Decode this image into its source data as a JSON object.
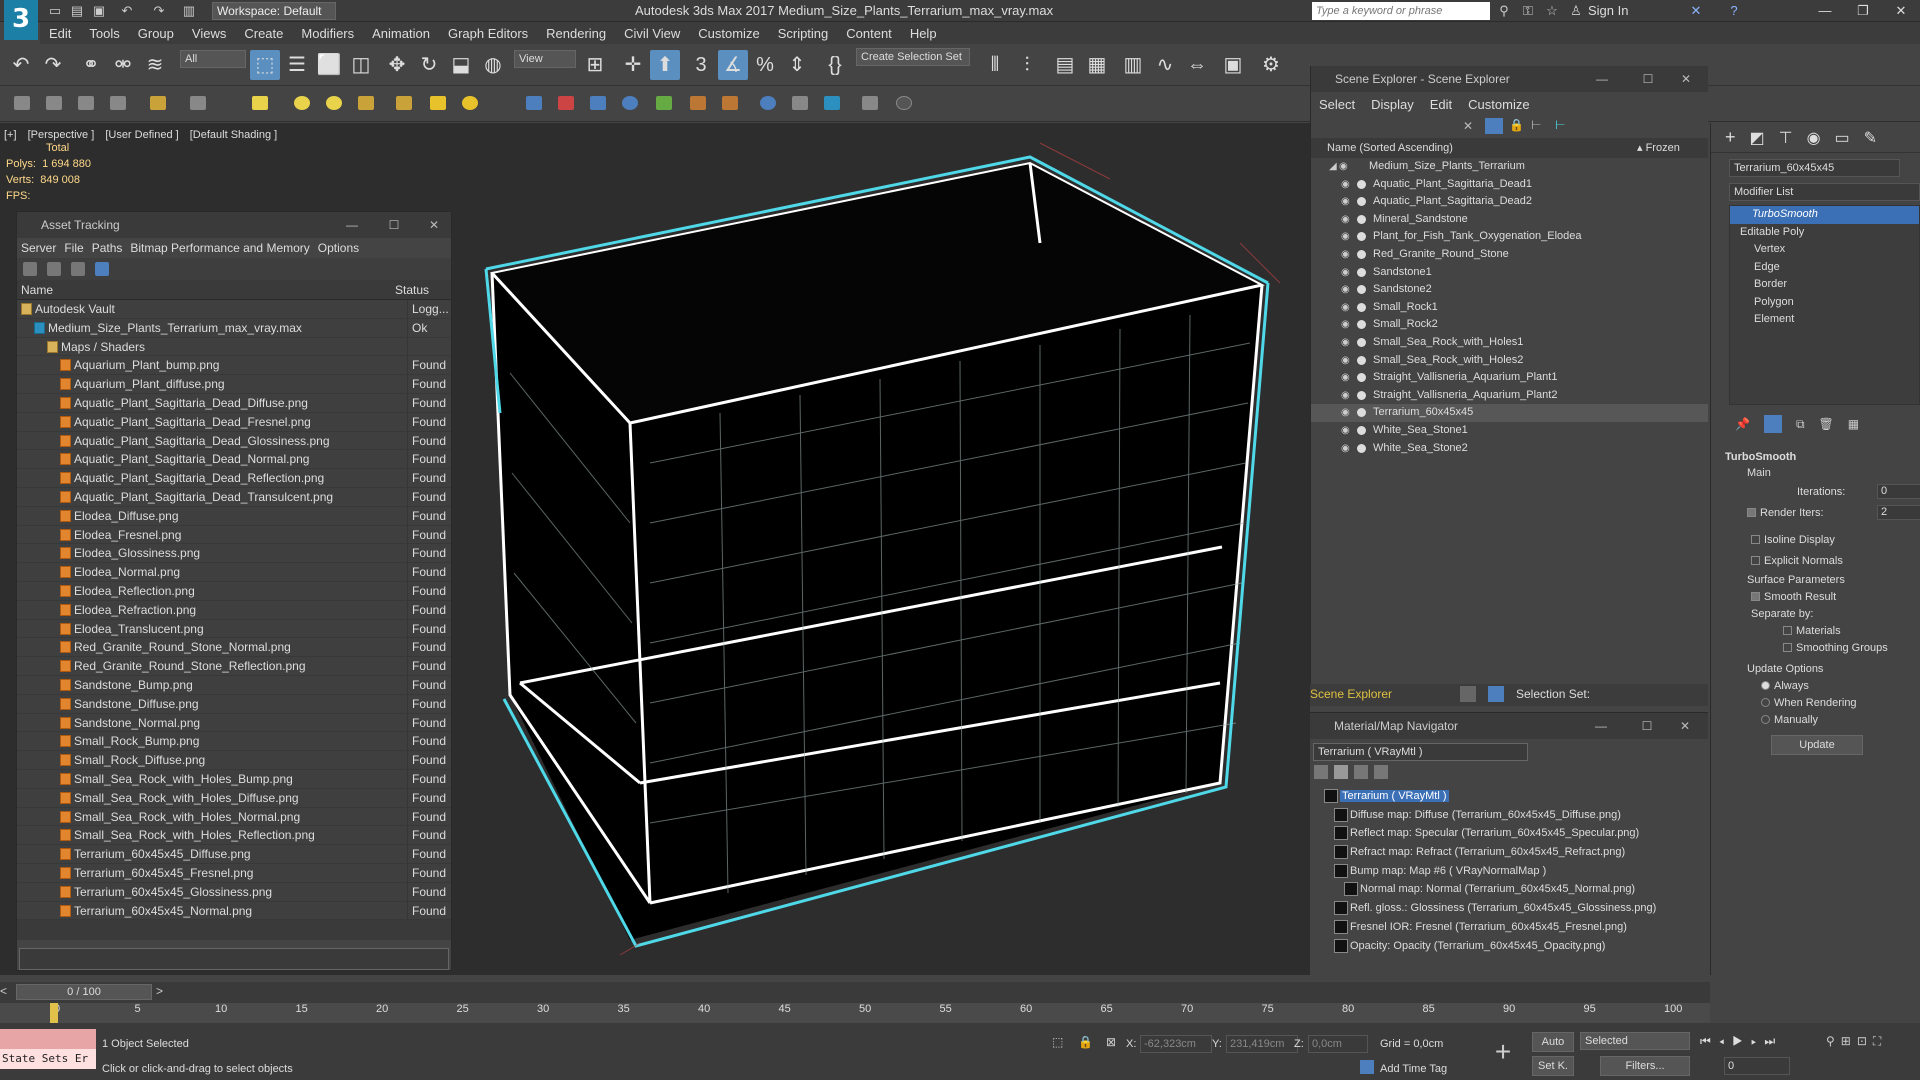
{
  "titlebar": {
    "logo": "3",
    "workspace": "Workspace: Default",
    "app_title": "Autodesk 3ds Max 2017     Medium_Size_Plants_Terrarium_max_vray.max",
    "search_placeholder": "Type a keyword or phrase",
    "sign_in": "Sign In"
  },
  "menubar": [
    "Edit",
    "Tools",
    "Group",
    "Views",
    "Create",
    "Modifiers",
    "Animation",
    "Graph Editors",
    "Rendering",
    "Civil View",
    "Customize",
    "Scripting",
    "Content",
    "Help"
  ],
  "toolbar": {
    "filter": "All",
    "view": "View",
    "selection_set": "Create Selection Set"
  },
  "viewport": {
    "labels": [
      "[+]",
      "[Perspective ]",
      "[User Defined ]",
      "[Default Shading ]"
    ],
    "stats_total": "Total",
    "polys_label": "Polys:",
    "polys_value": "1 694 880",
    "verts_label": "Verts:",
    "verts_value": "849 008",
    "fps": "FPS:"
  },
  "asset_tracking": {
    "title": "Asset Tracking",
    "menu": [
      "Server",
      "File",
      "Paths",
      "Bitmap Performance and Memory",
      "Options"
    ],
    "col_name": "Name",
    "col_status": "Status",
    "rows": [
      {
        "name": "Autodesk Vault",
        "status": "Logg...",
        "indent": 0,
        "icon": "fold"
      },
      {
        "name": "Medium_Size_Plants_Terrarium_max_vray.max",
        "status": "Ok",
        "indent": 1,
        "icon": "max"
      },
      {
        "name": "Maps / Shaders",
        "status": "",
        "indent": 2,
        "icon": "fold"
      },
      {
        "name": "Aquarium_Plant_bump.png",
        "status": "Found",
        "indent": 3,
        "icon": "file"
      },
      {
        "name": "Aquarium_Plant_diffuse.png",
        "status": "Found",
        "indent": 3,
        "icon": "file"
      },
      {
        "name": "Aquatic_Plant_Sagittaria_Dead_Diffuse.png",
        "status": "Found",
        "indent": 3,
        "icon": "file"
      },
      {
        "name": "Aquatic_Plant_Sagittaria_Dead_Fresnel.png",
        "status": "Found",
        "indent": 3,
        "icon": "file"
      },
      {
        "name": "Aquatic_Plant_Sagittaria_Dead_Glossiness.png",
        "status": "Found",
        "indent": 3,
        "icon": "file"
      },
      {
        "name": "Aquatic_Plant_Sagittaria_Dead_Normal.png",
        "status": "Found",
        "indent": 3,
        "icon": "file"
      },
      {
        "name": "Aquatic_Plant_Sagittaria_Dead_Reflection.png",
        "status": "Found",
        "indent": 3,
        "icon": "file"
      },
      {
        "name": "Aquatic_Plant_Sagittaria_Dead_Transulcent.png",
        "status": "Found",
        "indent": 3,
        "icon": "file"
      },
      {
        "name": "Elodea_Diffuse.png",
        "status": "Found",
        "indent": 3,
        "icon": "file"
      },
      {
        "name": "Elodea_Fresnel.png",
        "status": "Found",
        "indent": 3,
        "icon": "file"
      },
      {
        "name": "Elodea_Glossiness.png",
        "status": "Found",
        "indent": 3,
        "icon": "file"
      },
      {
        "name": "Elodea_Normal.png",
        "status": "Found",
        "indent": 3,
        "icon": "file"
      },
      {
        "name": "Elodea_Reflection.png",
        "status": "Found",
        "indent": 3,
        "icon": "file"
      },
      {
        "name": "Elodea_Refraction.png",
        "status": "Found",
        "indent": 3,
        "icon": "file"
      },
      {
        "name": "Elodea_Translucent.png",
        "status": "Found",
        "indent": 3,
        "icon": "file"
      },
      {
        "name": "Red_Granite_Round_Stone_Normal.png",
        "status": "Found",
        "indent": 3,
        "icon": "file"
      },
      {
        "name": "Red_Granite_Round_Stone_Reflection.png",
        "status": "Found",
        "indent": 3,
        "icon": "file"
      },
      {
        "name": "Sandstone_Bump.png",
        "status": "Found",
        "indent": 3,
        "icon": "file"
      },
      {
        "name": "Sandstone_Diffuse.png",
        "status": "Found",
        "indent": 3,
        "icon": "file"
      },
      {
        "name": "Sandstone_Normal.png",
        "status": "Found",
        "indent": 3,
        "icon": "file"
      },
      {
        "name": "Small_Rock_Bump.png",
        "status": "Found",
        "indent": 3,
        "icon": "file"
      },
      {
        "name": "Small_Rock_Diffuse.png",
        "status": "Found",
        "indent": 3,
        "icon": "file"
      },
      {
        "name": "Small_Sea_Rock_with_Holes_Bump.png",
        "status": "Found",
        "indent": 3,
        "icon": "file"
      },
      {
        "name": "Small_Sea_Rock_with_Holes_Diffuse.png",
        "status": "Found",
        "indent": 3,
        "icon": "file"
      },
      {
        "name": "Small_Sea_Rock_with_Holes_Normal.png",
        "status": "Found",
        "indent": 3,
        "icon": "file"
      },
      {
        "name": "Small_Sea_Rock_with_Holes_Reflection.png",
        "status": "Found",
        "indent": 3,
        "icon": "file"
      },
      {
        "name": "Terrarium_60x45x45_Diffuse.png",
        "status": "Found",
        "indent": 3,
        "icon": "file"
      },
      {
        "name": "Terrarium_60x45x45_Fresnel.png",
        "status": "Found",
        "indent": 3,
        "icon": "file"
      },
      {
        "name": "Terrarium_60x45x45_Glossiness.png",
        "status": "Found",
        "indent": 3,
        "icon": "file"
      },
      {
        "name": "Terrarium_60x45x45_Normal.png",
        "status": "Found",
        "indent": 3,
        "icon": "file"
      }
    ]
  },
  "scene_explorer": {
    "title": "Scene Explorer - Scene Explorer",
    "menu": [
      "Select",
      "Display",
      "Edit",
      "Customize"
    ],
    "col_name": "Name (Sorted Ascending)",
    "col_frozen": "▴ Frozen",
    "root": "Medium_Size_Plants_Terrarium",
    "items": [
      "Aquatic_Plant_Sagittaria_Dead1",
      "Aquatic_Plant_Sagittaria_Dead2",
      "Mineral_Sandstone",
      "Plant_for_Fish_Tank_Oxygenation_Elodea",
      "Red_Granite_Round_Stone",
      "Sandstone1",
      "Sandstone2",
      "Small_Rock1",
      "Small_Rock2",
      "Small_Sea_Rock_with_Holes1",
      "Small_Sea_Rock_with_Holes2",
      "Straight_Vallisneria_Aquarium_Plant1",
      "Straight_Vallisneria_Aquarium_Plant2",
      "Terrarium_60x45x45",
      "White_Sea_Stone1",
      "White_Sea_Stone2"
    ],
    "selected_item": "Terrarium_60x45x45",
    "footer_label": "Scene Explorer",
    "selection_set": "Selection Set:"
  },
  "material_navigator": {
    "title": "Material/Map Navigator",
    "field": "Terrarium  ( VRayMtl )",
    "rows": [
      {
        "text": "Terrarium  ( VRayMtl )",
        "indent": 0,
        "selected": true
      },
      {
        "text": "Diffuse map: Diffuse (Terrarium_60x45x45_Diffuse.png)",
        "indent": 1,
        "selected": false
      },
      {
        "text": "Reflect map: Specular (Terrarium_60x45x45_Specular.png)",
        "indent": 1,
        "selected": false
      },
      {
        "text": "Refract map: Refract (Terrarium_60x45x45_Refract.png)",
        "indent": 1,
        "selected": false
      },
      {
        "text": "Bump map: Map #6  ( VRayNormalMap )",
        "indent": 1,
        "selected": false
      },
      {
        "text": "Normal map: Normal (Terrarium_60x45x45_Normal.png)",
        "indent": 2,
        "selected": false
      },
      {
        "text": "Refl. gloss.: Glossiness (Terrarium_60x45x45_Glossiness.png)",
        "indent": 1,
        "selected": false
      },
      {
        "text": "Fresnel IOR: Fresnel (Terrarium_60x45x45_Fresnel.png)",
        "indent": 1,
        "selected": false
      },
      {
        "text": "Opacity: Opacity (Terrarium_60x45x45_Opacity.png)",
        "indent": 1,
        "selected": false
      }
    ]
  },
  "command_panel": {
    "object_name": "Terrarium_60x45x45",
    "modifier_list": "Modifier List",
    "stack": [
      {
        "text": "TurboSmooth",
        "level": 0,
        "selected": true
      },
      {
        "text": "Editable Poly",
        "level": 0,
        "selected": false
      },
      {
        "text": "Vertex",
        "level": 1,
        "selected": false
      },
      {
        "text": "Edge",
        "level": 1,
        "selected": false
      },
      {
        "text": "Border",
        "level": 1,
        "selected": false
      },
      {
        "text": "Polygon",
        "level": 1,
        "selected": false
      },
      {
        "text": "Element",
        "level": 1,
        "selected": false
      }
    ],
    "rollout_title": "TurboSmooth",
    "main_label": "Main",
    "iterations_label": "Iterations:",
    "iterations_value": "0",
    "render_iters_label": "Render Iters:",
    "render_iters_value": "2",
    "isoline": "Isoline Display",
    "explicit_normals": "Explicit Normals",
    "surface_params": "Surface Parameters",
    "smooth_result": "Smooth Result",
    "separate_by": "Separate by:",
    "materials": "Materials",
    "smoothing_groups": "Smoothing Groups",
    "update_options": "Update Options",
    "always": "Always",
    "when_rendering": "When Rendering",
    "manually": "Manually",
    "update_button": "Update"
  },
  "timeline": {
    "frame_counter": "0 / 100",
    "ticks": [
      "0",
      "5",
      "10",
      "15",
      "20",
      "25",
      "30",
      "35",
      "40",
      "45",
      "50",
      "55",
      "60",
      "65",
      "70",
      "75",
      "80",
      "85",
      "90",
      "95",
      "100"
    ]
  },
  "statusbar": {
    "maxscript": "State Sets Er",
    "selected": "1 Object Selected",
    "prompt": "Click or click-and-drag to select objects",
    "x_label": "X:",
    "x_value": "-62,323cm",
    "y_label": "Y:",
    "y_value": "231,419cm",
    "z_label": "Z:",
    "z_value": "0,0cm",
    "grid": "Grid = 0,0cm",
    "add_time_tag": "Add Time Tag",
    "auto": "Auto",
    "set_k": "Set K.",
    "selected_dd": "Selected",
    "filters": "Filters...",
    "frame": "0"
  }
}
